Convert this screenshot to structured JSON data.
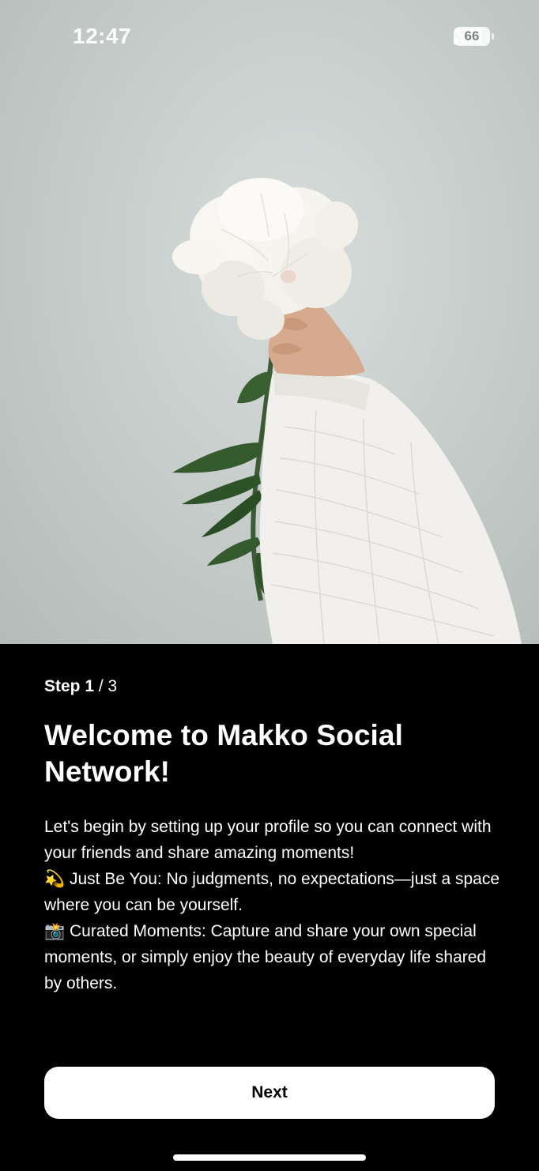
{
  "status_bar": {
    "time": "12:47",
    "battery": "66",
    "icons": [
      "cellular-signal-icon",
      "wifi-icon",
      "battery-icon"
    ]
  },
  "hero": {
    "image": "hand-holding-white-peony-photo"
  },
  "onboarding": {
    "step_current": "Step 1",
    "step_total": "/ 3",
    "title": "Welcome to Makko Social Network!",
    "intro": "Let's begin by setting up your profile so you can connect with your friends and share amazing moments!",
    "features": [
      {
        "emoji": "💫",
        "text": "Just Be You: No judgments, no expectations—just a space where you can be yourself."
      },
      {
        "emoji": "📸",
        "text": "Curated Moments: Capture and share your own special moments, or simply enjoy the beauty of everyday life shared by others."
      }
    ]
  },
  "actions": {
    "next_label": "Next"
  },
  "colors": {
    "background": "#000000",
    "button_bg": "#ffffff",
    "text": "#ffffff"
  }
}
